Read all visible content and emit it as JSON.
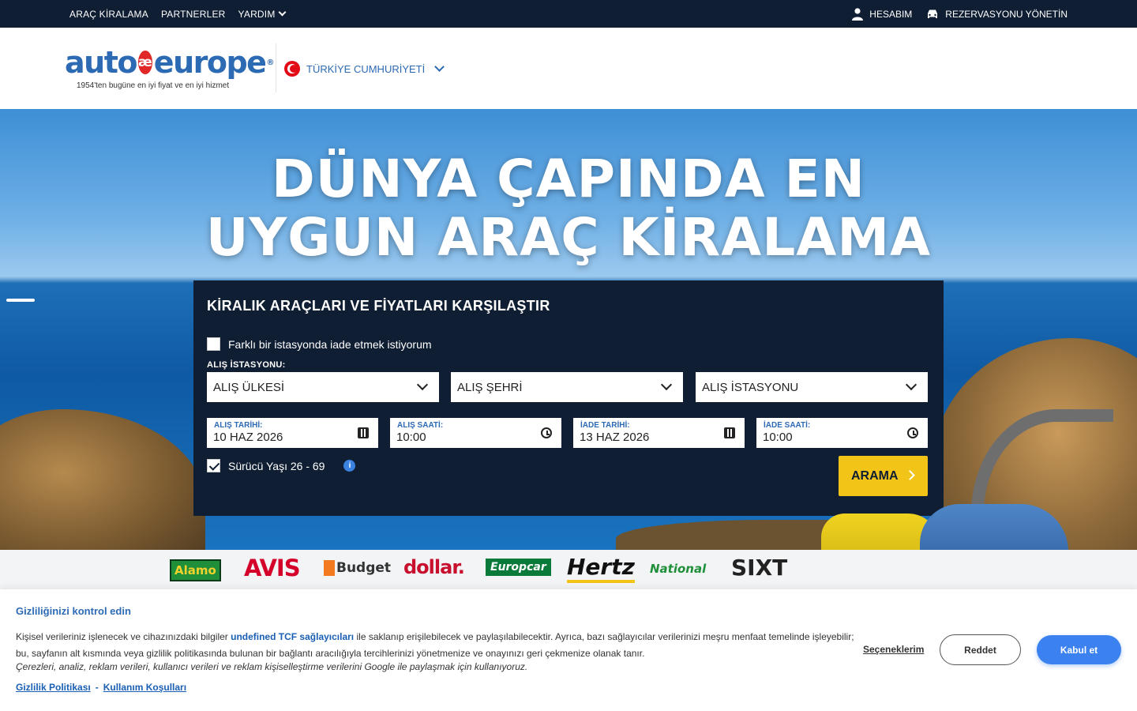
{
  "topbar": {
    "nav": [
      "ARAÇ KİRALAMA",
      "PARTNERLER",
      "YARDIM"
    ],
    "account": "HESABIM",
    "manage": "REZERVASYONU YÖNETİN"
  },
  "header": {
    "logo_left": "auto",
    "logo_mark": "æ",
    "logo_right": "europe",
    "logo_registered": "®",
    "tagline": "1954'ten bugüne en iyi fiyat ve en iyi hizmet",
    "country": "TÜRKİYE CUMHURİYETİ"
  },
  "hero": {
    "title_line1": "DÜNYA ÇAPINDA EN",
    "title_line2": "UYGUN ARAÇ KİRALAMA"
  },
  "search": {
    "heading": "KİRALIK ARAÇLARI VE FİYATLARI KARŞILAŞTIR",
    "different_return": "Farklı bir istasyonda iade etmek istiyorum",
    "pickup_station_label": "ALIŞ İSTASYONU:",
    "pickup_country": "ALIŞ ÜLKESİ",
    "pickup_city": "ALIŞ ŞEHRİ",
    "pickup_station": "ALIŞ İSTASYONU",
    "pickup_date_label": "ALIŞ TARİHİ:",
    "pickup_date": "10 HAZ 2026",
    "pickup_time_label": "ALIŞ SAATİ:",
    "pickup_time": "10:00",
    "return_date_label": "İADE TARİHİ:",
    "return_date": "13 HAZ 2026",
    "return_time_label": "İADE SAATİ:",
    "return_time": "10:00",
    "driver_age": "Sürücü Yaşı 26 - 69",
    "info_glyph": "i",
    "button": "ARAMA"
  },
  "brands": [
    "Alamo",
    "AVIS",
    "Budget",
    "dollar.",
    "Europcar",
    "Hertz",
    "National",
    "SIXT"
  ],
  "cookie": {
    "title": "Gizliliğinizi kontrol edin",
    "text_before": "Kişisel verileriniz işlenecek ve cihazınızdaki bilgiler ",
    "link_vendors": "undefined TCF sağlayıcıları",
    "text_after": " ile saklanıp erişilebilecek ve paylaşılabilecektir. Ayrıca, bazı sağlayıcılar verilerinizi meşru menfaat temelinde işleyebilir; bu, sayfanın alt kısmında veya gizlilik politikasında bulunan bir bağlantı aracılığıyla tercihlerinizi yönetmenize ve onayınızı geri çekmenize olanak tanır.",
    "google_note": "Çerezleri, analiz, reklam verileri, kullanıcı verileri ve reklam kişiselleştirme verilerini Google ile paylaşmak için kullanıyoruz.",
    "privacy_link": "Gizlilik Politikası",
    "separator": "-",
    "terms_link": "Kullanım Koşulları",
    "options": "Seçeneklerim",
    "reject": "Reddet",
    "accept": "Kabul et"
  },
  "colors": {
    "navy": "#0f1e33",
    "brand_blue": "#2d6ab4",
    "yellow": "#f2c418",
    "accept_blue": "#3b82f0"
  }
}
